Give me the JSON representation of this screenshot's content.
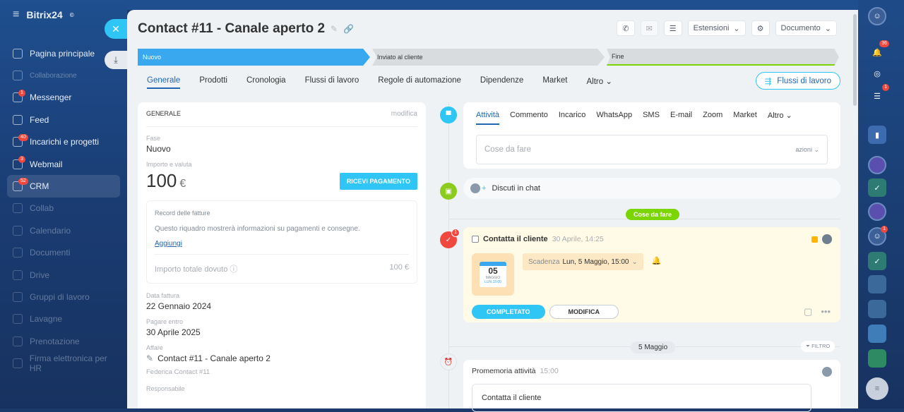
{
  "app": {
    "logo": "Bitrix24",
    "logo_symbol": "©"
  },
  "sidebar": {
    "items": [
      {
        "label": "Pagina principale",
        "badge": ""
      },
      {
        "label": "Collaborazione",
        "badge": ""
      },
      {
        "label": "Messenger",
        "badge": "1"
      },
      {
        "label": "Feed",
        "badge": ""
      },
      {
        "label": "Incarichi e progetti",
        "badge": "40"
      },
      {
        "label": "Webmail",
        "badge": "3"
      },
      {
        "label": "CRM",
        "badge": "52"
      },
      {
        "label": "Collab",
        "badge": ""
      },
      {
        "label": "Calendario",
        "badge": ""
      },
      {
        "label": "Documenti",
        "badge": ""
      },
      {
        "label": "Drive",
        "badge": ""
      },
      {
        "label": "Gruppi di lavoro",
        "badge": ""
      },
      {
        "label": "Lavagne",
        "badge": ""
      },
      {
        "label": "Prenotazione",
        "badge": ""
      },
      {
        "label": "Firma elettronica per HR",
        "badge": ""
      }
    ]
  },
  "right_sidebar": {
    "notification_badge": "36",
    "chat_badge": "1",
    "avatar_badge": "1"
  },
  "header": {
    "title": "Contact #11 - Canale aperto 2",
    "toolbar": {
      "extensions": "Estensioni",
      "document": "Documento"
    }
  },
  "stages": [
    "Nuovo",
    "Inviato al cliente",
    "Fine"
  ],
  "tabs": [
    "Generale",
    "Prodotti",
    "Cronologia",
    "Flussi di lavoro",
    "Regole di automazione",
    "Dipendenze",
    "Market",
    "Altro"
  ],
  "flussi_button": "Flussi di lavoro",
  "general": {
    "section_title": "GENERALE",
    "edit": "modifica",
    "phase_label": "Fase",
    "phase_value": "Nuovo",
    "amount_label": "Importo e valuta",
    "amount_value": "100",
    "currency": "€",
    "pay_button": "RICEVI PAGAMENTO",
    "invoice_title": "Record delle fatture",
    "invoice_desc": "Questo riquadro mostrerà informazioni su pagamenti e consegne.",
    "invoice_add": "Aggiungi",
    "invoice_total_label": "Importo totale dovuto",
    "invoice_total_value": "100 €",
    "invoice_date_label": "Data fattura",
    "invoice_date_value": "22 Gennaio 2024",
    "pay_by_label": "Pagare entro",
    "pay_by_value": "30 Aprile 2025",
    "deal_label": "Affare",
    "deal_value": "Contact #11 - Canale aperto 2",
    "deal_sub": "Federica Contact #11",
    "responsible_label": "Responsabile"
  },
  "activity": {
    "tabs": [
      "Attività",
      "Commento",
      "Incarico",
      "WhatsApp",
      "SMS",
      "E-mail",
      "Zoom",
      "Market",
      "Altro"
    ],
    "todo_placeholder": "Cose da fare",
    "actions": "azioni",
    "chat": "Discuti in chat",
    "section_pill": "Cose da fare"
  },
  "task": {
    "title": "Contatta il cliente",
    "created": "30 Aprile, 14:25",
    "badge": "1",
    "cal_day": "05",
    "cal_month": "MAGGIO",
    "cal_time": "LUN 15:00",
    "deadline_label": "Scadenza",
    "deadline_value": "Lun, 5 Maggio, 15:00",
    "done_button": "COMPLETATO",
    "edit_button": "MODIFICA"
  },
  "timeline": {
    "date_pill": "5 Maggio",
    "filter": "FILTRO",
    "reminder_title": "Promemoria attività",
    "reminder_time": "15:00",
    "reminder_text": "Contatta il cliente"
  }
}
